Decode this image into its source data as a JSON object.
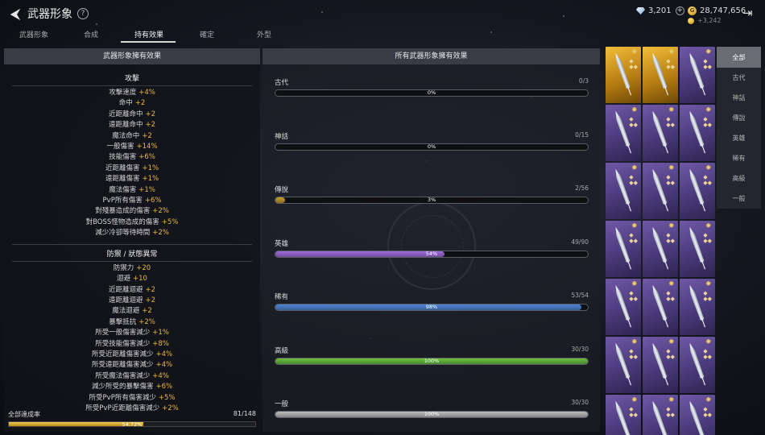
{
  "header": {
    "title": "武器形象",
    "help_icon": "?",
    "diamonds": "3,201",
    "gold": "28,747,656",
    "gold_sub": "+3,242"
  },
  "tabs": [
    {
      "label": "武器形象",
      "active": false
    },
    {
      "label": "合成",
      "active": false
    },
    {
      "label": "持有效果",
      "active": true
    },
    {
      "label": "確定",
      "active": false
    },
    {
      "label": "外型",
      "active": false
    }
  ],
  "left_panel": {
    "title": "武器形象擁有效果",
    "attack": {
      "title": "攻擊",
      "stats": [
        {
          "name": "攻擊速度",
          "value": "+4%"
        },
        {
          "name": "命中",
          "value": "+2"
        },
        {
          "name": "近距離命中",
          "value": "+2"
        },
        {
          "name": "遠距離命中",
          "value": "+2"
        },
        {
          "name": "魔法命中",
          "value": "+2"
        },
        {
          "name": "一般傷害",
          "value": "+14%"
        },
        {
          "name": "技能傷害",
          "value": "+6%"
        },
        {
          "name": "近距離傷害",
          "value": "+1%"
        },
        {
          "name": "遠距離傷害",
          "value": "+1%"
        },
        {
          "name": "魔法傷害",
          "value": "+1%"
        },
        {
          "name": "PvP所有傷害",
          "value": "+6%"
        },
        {
          "name": "對殘暴造成的傷害",
          "value": "+2%"
        },
        {
          "name": "對BOSS怪物造成的傷害",
          "value": "+5%"
        },
        {
          "name": "減少冷卻等待時間",
          "value": "+2%"
        }
      ]
    },
    "defense": {
      "title": "防禦 / 狀態異常",
      "stats": [
        {
          "name": "防禦力",
          "value": "+20"
        },
        {
          "name": "迴避",
          "value": "+10"
        },
        {
          "name": "近距離迴避",
          "value": "+2"
        },
        {
          "name": "遠距離迴避",
          "value": "+2"
        },
        {
          "name": "魔法迴避",
          "value": "+2"
        },
        {
          "name": "暴擊抵抗",
          "value": "+2%"
        },
        {
          "name": "所受一般傷害減少",
          "value": "+1%"
        },
        {
          "name": "所受技能傷害減少",
          "value": "+8%"
        },
        {
          "name": "所受近距離傷害減少",
          "value": "+4%"
        },
        {
          "name": "所受遠距離傷害減少",
          "value": "+4%"
        },
        {
          "name": "所受魔法傷害減少",
          "value": "+4%"
        },
        {
          "name": "減少所受的暴擊傷害",
          "value": "+6%"
        },
        {
          "name": "所受PvP所有傷害減少",
          "value": "+5%"
        },
        {
          "name": "所受PvP近距離傷害減少",
          "value": "+2%"
        }
      ]
    },
    "total": {
      "label": "全部達成率",
      "count": "81/148",
      "percent_text": "54.72%",
      "fraction": 0.5472
    }
  },
  "middle_panel": {
    "title": "所有武器形象擁有效果",
    "rarities": [
      {
        "name": "古代",
        "count": "0/3",
        "percent": "0%",
        "fraction": 0.0,
        "color": "#8a8a8a"
      },
      {
        "name": "神話",
        "count": "0/15",
        "percent": "0%",
        "fraction": 0.0,
        "color": "#8a8a8a"
      },
      {
        "name": "傳說",
        "count": "2/56",
        "percent": "3%",
        "fraction": 0.03,
        "color": "#c79a2c"
      },
      {
        "name": "英雄",
        "count": "49/90",
        "percent": "54%",
        "fraction": 0.54,
        "color": "#a06ae0"
      },
      {
        "name": "稀有",
        "count": "53/54",
        "percent": "98%",
        "fraction": 0.98,
        "color": "#4c86d8"
      },
      {
        "name": "高級",
        "count": "30/30",
        "percent": "100%",
        "fraction": 1.0,
        "color": "#6ac23e"
      },
      {
        "name": "一般",
        "count": "30/30",
        "percent": "100%",
        "fraction": 1.0,
        "color": "#bdbdbd"
      }
    ]
  },
  "weapon_grid": [
    "gold",
    "gold",
    "purple",
    "purple",
    "purple",
    "purple",
    "purple",
    "purple",
    "purple",
    "purple",
    "purple",
    "purple",
    "purple",
    "purple",
    "purple",
    "purple",
    "purple",
    "purple",
    "purple",
    "purple",
    "purple"
  ],
  "filters": [
    {
      "label": "全部",
      "active": true
    },
    {
      "label": "古代",
      "active": false
    },
    {
      "label": "神話",
      "active": false
    },
    {
      "label": "傳說",
      "active": false
    },
    {
      "label": "英雄",
      "active": false
    },
    {
      "label": "稀有",
      "active": false
    },
    {
      "label": "高級",
      "active": false
    },
    {
      "label": "一般",
      "active": false
    }
  ]
}
